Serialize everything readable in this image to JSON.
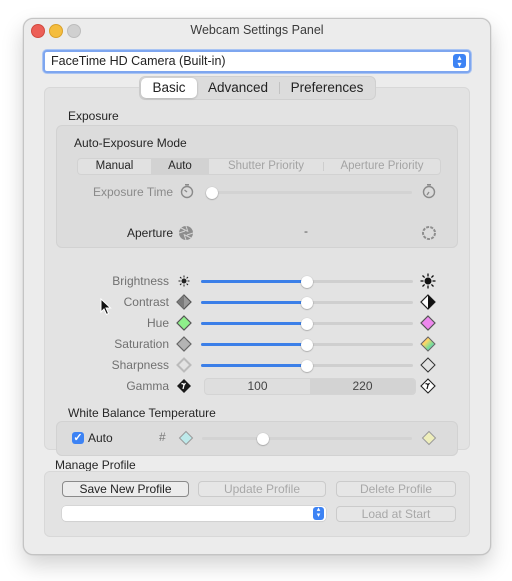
{
  "window": {
    "title": "Webcam Settings Panel"
  },
  "camera_select": {
    "value": "FaceTime HD Camera (Built-in)"
  },
  "tabs": [
    {
      "label": "Basic",
      "active": true
    },
    {
      "label": "Advanced",
      "active": false
    },
    {
      "label": "Preferences",
      "active": false
    }
  ],
  "exposure": {
    "section_label": "Exposure",
    "mode_label": "Auto-Exposure Mode",
    "modes": [
      {
        "label": "Manual",
        "selected": false,
        "enabled": true
      },
      {
        "label": "Auto",
        "selected": true,
        "enabled": true
      },
      {
        "label": "Shutter Priority",
        "selected": false,
        "enabled": false
      },
      {
        "label": "Aperture Priority",
        "selected": false,
        "enabled": false
      }
    ],
    "exposure_time": {
      "label": "Exposure Time",
      "value_fraction": 0.02,
      "enabled": false,
      "min_icon": "stopwatch-icon",
      "max_icon": "stopwatch-full-icon"
    },
    "aperture": {
      "label": "Aperture",
      "value": "-",
      "min_icon": "aperture-closed-icon",
      "max_icon": "aperture-open-icon"
    }
  },
  "adjustments": [
    {
      "label": "Brightness",
      "value_fraction": 0.5,
      "min_icon": "sun-small-icon",
      "max_icon": "sun-large-icon"
    },
    {
      "label": "Contrast",
      "value_fraction": 0.5,
      "min_icon": "contrast-low-icon",
      "max_icon": "contrast-high-icon"
    },
    {
      "label": "Hue",
      "value_fraction": 0.5,
      "min_icon": "hue-green-icon",
      "max_icon": "hue-magenta-icon"
    },
    {
      "label": "Saturation",
      "value_fraction": 0.5,
      "min_icon": "saturation-gray-icon",
      "max_icon": "saturation-color-icon"
    },
    {
      "label": "Sharpness",
      "value_fraction": 0.5,
      "min_icon": "sharpness-soft-icon",
      "max_icon": "sharpness-sharp-icon"
    }
  ],
  "gamma": {
    "label": "Gamma",
    "value_left": "100",
    "value_right": "220",
    "min_icon": "gamma-dark-icon",
    "max_icon": "gamma-light-icon"
  },
  "white_balance": {
    "section_label": "White Balance Temperature",
    "auto_label": "Auto",
    "auto_checked": true,
    "hash_label": "#",
    "value_fraction": 0.29,
    "min_icon": "cool-temp-icon",
    "max_icon": "warm-temp-icon"
  },
  "profile": {
    "section_label": "Manage Profile",
    "save_label": "Save New Profile",
    "update_label": "Update Profile",
    "delete_label": "Delete Profile",
    "load_label": "Load at Start",
    "select_value": ""
  },
  "colors": {
    "accent": "#3b7fe8",
    "hue_min": "#8ef08a",
    "hue_max": "#ee88ee",
    "wb_min": "#bde9ea",
    "wb_max": "#eeeebb"
  }
}
